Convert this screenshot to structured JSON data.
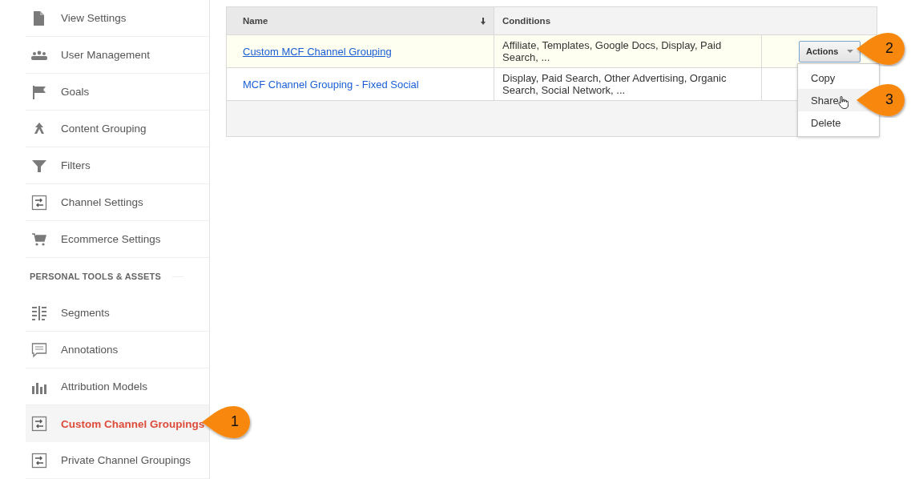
{
  "sidebar": {
    "items": [
      {
        "label": "View Settings",
        "selected": false
      },
      {
        "label": "User Management",
        "selected": false
      },
      {
        "label": "Goals",
        "selected": false
      },
      {
        "label": "Content Grouping",
        "selected": false
      },
      {
        "label": "Filters",
        "selected": false
      },
      {
        "label": "Channel Settings",
        "selected": false
      },
      {
        "label": "Ecommerce Settings",
        "selected": false
      }
    ],
    "section_title": "PERSONAL TOOLS & ASSETS",
    "section_items": [
      {
        "label": "Segments",
        "selected": false
      },
      {
        "label": "Annotations",
        "selected": false
      },
      {
        "label": "Attribution Models",
        "selected": false
      },
      {
        "label": "Custom Channel Groupings",
        "selected": true
      },
      {
        "label": "Private Channel Groupings",
        "selected": false
      }
    ]
  },
  "table": {
    "columns": [
      "Name",
      "Conditions"
    ],
    "rows": [
      {
        "name": "Custom MCF Channel Grouping",
        "conditions": "Affiliate, Templates, Google Docs, Display, Paid Search, ...",
        "selected": true,
        "action": "Actions"
      },
      {
        "name": "MCF Channel Grouping - Fixed Social",
        "conditions": "Display, Paid Search, Other Advertising, Organic Search, Social Network, ...",
        "selected": false
      }
    ]
  },
  "actions_menu": {
    "items": [
      {
        "label": "Copy",
        "selected": false
      },
      {
        "label": "Share",
        "selected": true
      },
      {
        "label": "Delete",
        "selected": false
      }
    ]
  },
  "callouts": [
    {
      "number": "1"
    },
    {
      "number": "2"
    },
    {
      "number": "3"
    }
  ]
}
